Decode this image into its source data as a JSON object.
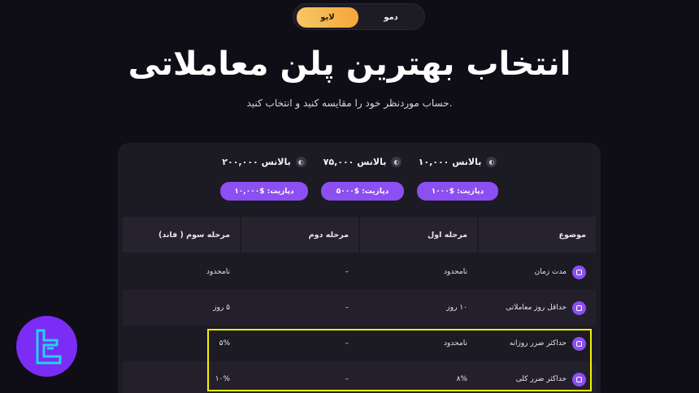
{
  "toggle": {
    "demo": "دمو",
    "live": "لایو"
  },
  "headline": "انتخاب بهترین پلن معاملاتی",
  "subline": "حساب موردنظر خود را مقایسه کنید و انتخاب کنید.",
  "plans": [
    {
      "balance": "۱۰,۰۰۰ بالانس",
      "deposit": "دپازیت: $۱۰۰۰"
    },
    {
      "balance": "۷۵,۰۰۰ بالانس",
      "deposit": "دپازیت: $۵۰۰۰"
    },
    {
      "balance": "۲۰۰,۰۰۰ بالانس",
      "deposit": "دپازیت: $۱۰,۰۰۰"
    }
  ],
  "table": {
    "headers": {
      "topic": "موضوع",
      "phase1": "مرحله اول",
      "phase2": "مرحله دوم",
      "phase3": "مرحله سوم ( فاند)"
    },
    "rows": [
      {
        "topic": "مدت زمان",
        "phase1": "نامحدود",
        "phase2": "–",
        "phase3": "نامحدود",
        "icon": "clock-icon"
      },
      {
        "topic": "حداقل روز معاملاتی",
        "phase1": "۱۰ روز",
        "phase2": "–",
        "phase3": "۵ روز",
        "icon": "calendar-icon"
      },
      {
        "topic": "حداکثر ضرر روزانه",
        "phase1": "نامحدود",
        "phase2": "–",
        "phase3": "۵%",
        "icon": "gauge-icon"
      },
      {
        "topic": "حداکثر ضرر کلی",
        "phase1": "۸%",
        "phase2": "–",
        "phase3": "۱۰%",
        "icon": "download-icon"
      }
    ]
  },
  "colors": {
    "accent": "#8b4ff2",
    "live_toggle": "#f4a63a",
    "highlight": "#f3f200",
    "logo_bg": "#7b2cf5",
    "logo_mark": "#22d3ee"
  }
}
